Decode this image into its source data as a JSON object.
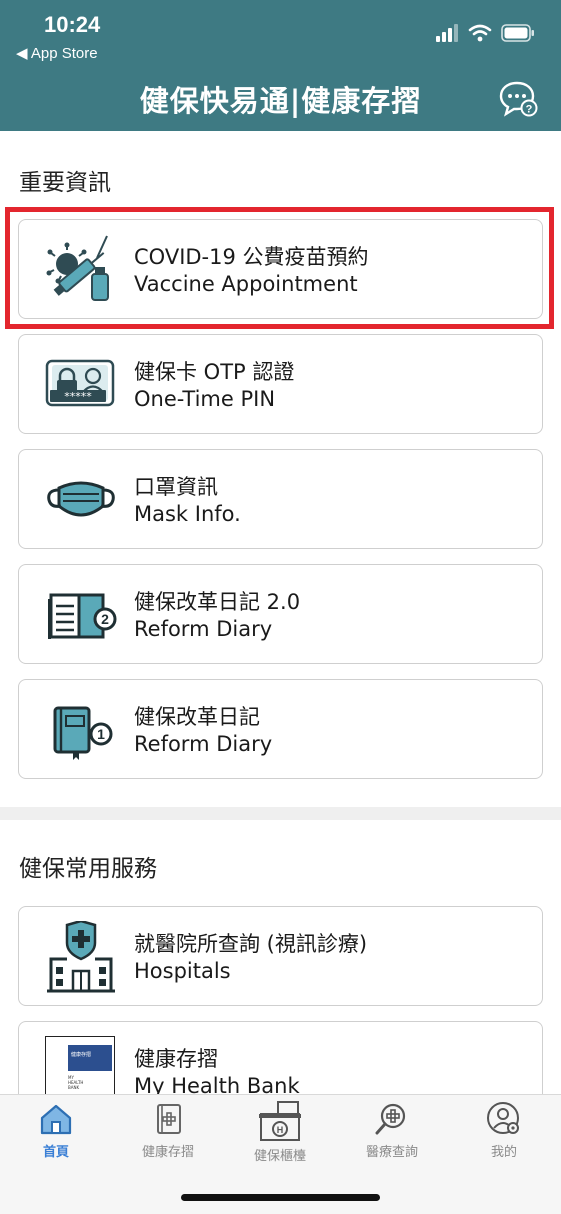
{
  "status_bar": {
    "time": "10:24",
    "back_label": "◀ App Store"
  },
  "header": {
    "title": "健保快易通|健康存摺"
  },
  "sections": [
    {
      "title": "重要資訊"
    },
    {
      "title": "健保常用服務"
    }
  ],
  "important_items": [
    {
      "zh": "COVID-19 公費疫苗預約",
      "en": "Vaccine Appointment",
      "icon": "vaccine-icon"
    },
    {
      "zh": "健保卡 OTP 認證",
      "en": "One-Time PIN",
      "icon": "otp-card-icon"
    },
    {
      "zh": "口罩資訊",
      "en": "Mask Info.",
      "icon": "mask-icon"
    },
    {
      "zh": "健保改革日記 2.0",
      "en": "Reform Diary",
      "icon": "diary-2-icon"
    },
    {
      "zh": "健保改革日記",
      "en": "Reform Diary",
      "icon": "diary-1-icon"
    }
  ],
  "service_items": [
    {
      "zh": "就醫院所查詢 (視訊診療)",
      "en": "Hospitals",
      "icon": "hospital-icon"
    },
    {
      "zh": "健康存摺",
      "en": "My Health Bank",
      "icon": "health-bank-book-icon",
      "icon_text": [
        "健康存摺",
        "MY",
        "HEALTH",
        "BANK"
      ]
    }
  ],
  "tabs": [
    {
      "label": "首頁",
      "active": true,
      "icon": "home-icon"
    },
    {
      "label": "健康存摺",
      "active": false,
      "icon": "health-record-icon"
    },
    {
      "label": "健保櫃檯",
      "active": false,
      "icon": "counter-icon"
    },
    {
      "label": "醫療查詢",
      "active": false,
      "icon": "medical-search-icon"
    },
    {
      "label": "我的",
      "active": false,
      "icon": "profile-settings-icon"
    }
  ],
  "colors": {
    "header": "#3e7a83",
    "accent_icon": "#5aa9b8",
    "highlight": "#e3262e",
    "tab_active": "#3a7fd5"
  }
}
